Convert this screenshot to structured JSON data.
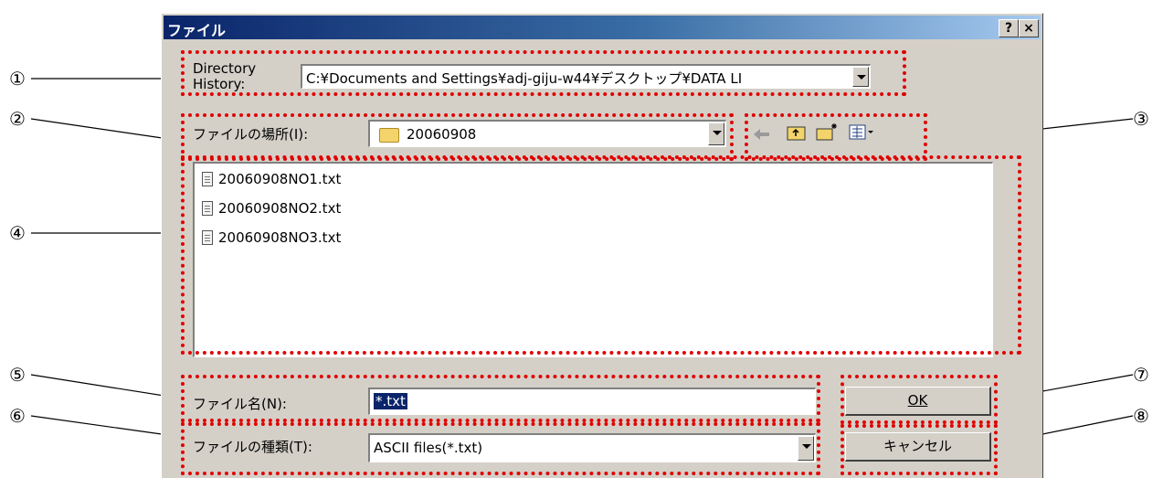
{
  "window": {
    "title": "ファイル",
    "help_label": "?",
    "close_label": "×"
  },
  "directory_history": {
    "label": "Directory History:",
    "value": "C:¥Documents and Settings¥adj-giju-w44¥デスクトップ¥DATA LI"
  },
  "look_in": {
    "label": "ファイルの場所(I):",
    "folder": "20060908"
  },
  "files": [
    "20060908NO1.txt",
    "20060908NO2.txt",
    "20060908NO3.txt"
  ],
  "filename": {
    "label": "ファイル名(N):",
    "value": "*.txt"
  },
  "filetype": {
    "label": "ファイルの種類(T):",
    "value": "ASCII files(*.txt)"
  },
  "buttons": {
    "ok": "OK",
    "cancel": "キャンセル"
  },
  "callouts": [
    "①",
    "②",
    "③",
    "④",
    "⑤",
    "⑥",
    "⑦",
    "⑧"
  ],
  "colors": {
    "highlight": "#e00000",
    "titlebar": "#0a246a",
    "selection": "#0a246a"
  }
}
